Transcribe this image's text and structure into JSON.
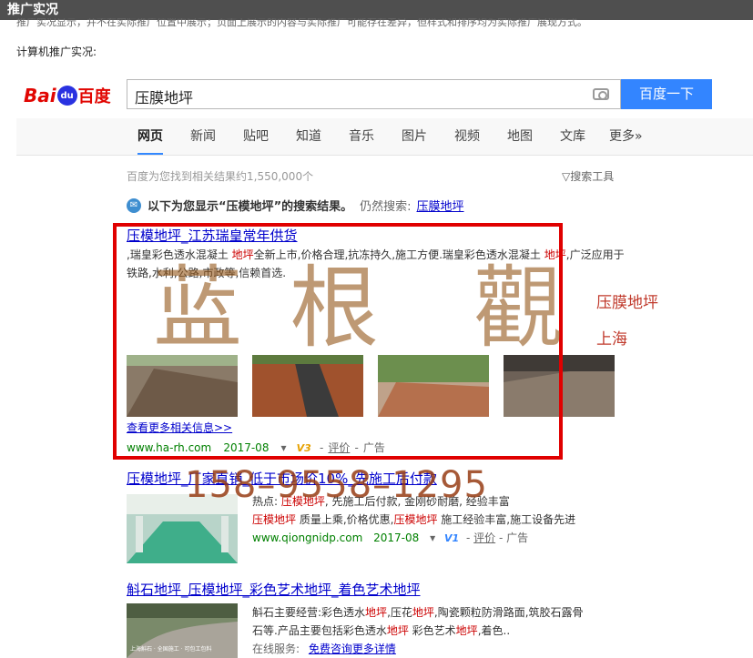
{
  "titlebar": "推广实况",
  "faded_line": "推广实况显示，并不在实际推广位置中展示；页面上展示的内容与实际推广可能存在差异，但样式和排序均为实际推广展现方式。",
  "intro": "计算机推广实况:",
  "logo": {
    "bai": "Bai",
    "paw": "du",
    "cn": "百度"
  },
  "search": {
    "query": "压膜地坪",
    "button": "百度一下"
  },
  "tabs": [
    "网页",
    "新闻",
    "贴吧",
    "知道",
    "音乐",
    "图片",
    "视频",
    "地图",
    "文库",
    "更多»"
  ],
  "result_count": "百度为您找到相关结果约1,550,000个",
  "tools": "搜索工具",
  "notice": {
    "icon": "✉",
    "prefix": "以下为您显示“",
    "kw": "压模地坪",
    "suffix": "”的搜索结果。",
    "still": "仍然搜索:",
    "link": "压膜地坪"
  },
  "result1": {
    "title": "压模地坪_江苏瑞皇常年供货",
    "desc": [
      {
        "t": ",瑞皇彩色透水混凝土 ",
        "em": false
      },
      {
        "t": "地坪",
        "em": true
      },
      {
        "t": "全新上市,价格合理,抗冻持久,施工方便.瑞皇彩色透水混凝土 ",
        "em": false
      },
      {
        "t": "地坪",
        "em": true
      },
      {
        "t": ",广泛应用于铁路,水利,公路,市政等,信赖首选.",
        "em": false
      }
    ],
    "more": "查看更多相关信息>>",
    "url": "www.ha-rh.com",
    "date": "2017-08",
    "badge": "V3",
    "comment": "评价",
    "ad": "广告"
  },
  "result2": {
    "title": "压模地坪_厂家直销_低于市场价10%_先施工后付款",
    "line1": [
      {
        "t": "热点: ",
        "em": false
      },
      {
        "t": "压模地坪",
        "em": true
      },
      {
        "t": ", 先施工后付款, 金刚砂耐磨, 经验丰富",
        "em": false
      }
    ],
    "line2": [
      {
        "t": "压模地坪",
        "em": true
      },
      {
        "t": " 质量上乘,价格优惠,",
        "em": false
      },
      {
        "t": "压模地坪",
        "em": true
      },
      {
        "t": " 施工经验丰富,施工设备先进",
        "em": false
      }
    ],
    "url": "www.qiongnidp.com",
    "date": "2017-08",
    "badge": "V1",
    "comment": "评价",
    "ad": "广告"
  },
  "result3": {
    "title": "斛石地坪_压模地坪_彩色艺术地坪_着色艺术地坪",
    "line1": [
      {
        "t": "斛石主要经营:彩色透水",
        "em": false
      },
      {
        "t": "地坪",
        "em": true
      },
      {
        "t": ",压花",
        "em": false
      },
      {
        "t": "地坪",
        "em": true
      },
      {
        "t": ",陶瓷颗粒防滑路面,筑胶石露骨",
        "em": false
      }
    ],
    "line2": [
      {
        "t": "石等.产品主要包括彩色透水",
        "em": false
      },
      {
        "t": "地坪",
        "em": true
      },
      {
        "t": " 彩色艺术",
        "em": false
      },
      {
        "t": "地坪",
        "em": true
      },
      {
        "t": ",着色..",
        "em": false
      }
    ],
    "service_label": "在线服务:",
    "service_link": "免费咨询更多详情",
    "img_text": "上海斛石 · 全国施工 · 可包工包料"
  },
  "watermark": {
    "chars": [
      "蓝",
      "根",
      "觀"
    ],
    "label1": "压膜地坪",
    "label2": "上海",
    "phone": "158–9558–1295"
  },
  "colors": {
    "link": "#0000cc",
    "keyword": "#cc0000",
    "url": "#008000",
    "button": "#3385ff",
    "highlight_box": "#e00000"
  }
}
